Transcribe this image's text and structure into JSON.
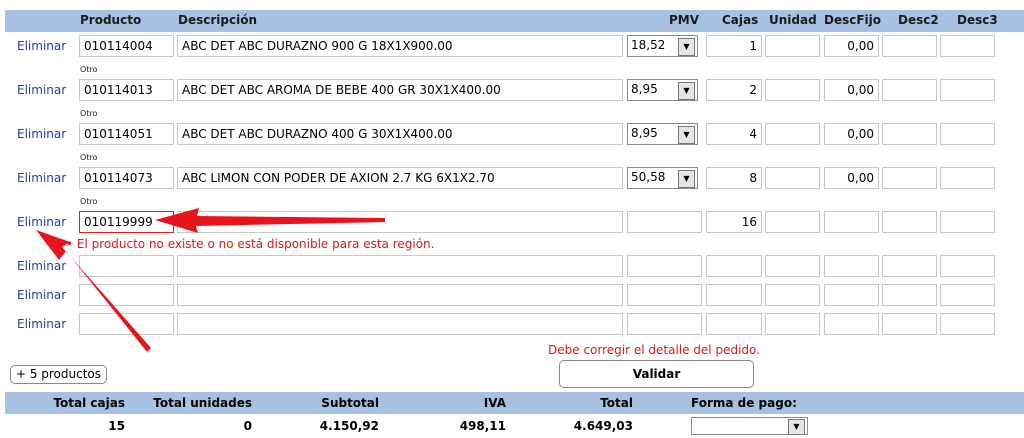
{
  "header": {
    "producto": "Producto",
    "descripcion": "Descripción",
    "pmv": "PMV",
    "cajas": "Cajas",
    "unidad": "Unidad",
    "descfijo": "DescFijo",
    "desc2": "Desc2",
    "desc3": "Desc3"
  },
  "rows": [
    {
      "action": "Eliminar",
      "code": "010114004",
      "desc": "ABC DET ABC DURAZNO 900 G 18X1X900.00",
      "pmv": "18,52",
      "cajas": "1",
      "unidad": "",
      "descfijo": "0,00",
      "desc2": "",
      "desc3": "",
      "otro": "Otro"
    },
    {
      "action": "Eliminar",
      "code": "010114013",
      "desc": "ABC DET ABC AROMA DE BEBE 400 GR 30X1X400.00",
      "pmv": "8,95",
      "cajas": "2",
      "unidad": "",
      "descfijo": "0,00",
      "desc2": "",
      "desc3": "",
      "otro": "Otro"
    },
    {
      "action": "Eliminar",
      "code": "010114051",
      "desc": "ABC DET ABC DURAZNO 400 G 30X1X400.00",
      "pmv": "8,95",
      "cajas": "4",
      "unidad": "",
      "descfijo": "0,00",
      "desc2": "",
      "desc3": "",
      "otro": "Otro"
    },
    {
      "action": "Eliminar",
      "code": "010114073",
      "desc": "ABC LIMON CON PODER DE AXION 2.7 KG 6X1X2.70",
      "pmv": "50,58",
      "cajas": "8",
      "unidad": "",
      "descfijo": "0,00",
      "desc2": "",
      "desc3": "",
      "otro": "Otro"
    },
    {
      "action": "Eliminar",
      "code": "010119999",
      "desc": "",
      "pmv": "",
      "cajas": "16",
      "unidad": "",
      "descfijo": "",
      "desc2": "",
      "desc3": ""
    },
    {
      "action": "Eliminar",
      "code": "",
      "desc": "",
      "pmv": "",
      "cajas": "",
      "unidad": "",
      "descfijo": "",
      "desc2": "",
      "desc3": ""
    },
    {
      "action": "Eliminar",
      "code": "",
      "desc": "",
      "pmv": "",
      "cajas": "",
      "unidad": "",
      "descfijo": "",
      "desc2": "",
      "desc3": ""
    },
    {
      "action": "Eliminar",
      "code": "",
      "desc": "",
      "pmv": "",
      "cajas": "",
      "unidad": "",
      "descfijo": "",
      "desc2": "",
      "desc3": ""
    }
  ],
  "row_error": "• El producto no existe o no está disponible para esta región.",
  "detail_error": "Debe corregir el detalle del pedido.",
  "add_products_label": "+ 5 productos",
  "validate_label": "Validar",
  "totals": {
    "headers": {
      "total_cajas": "Total cajas",
      "total_unidades": "Total unidades",
      "subtotal": "Subtotal",
      "iva": "IVA",
      "total": "Total",
      "forma_pago": "Forma de pago:"
    },
    "values": {
      "total_cajas": "15",
      "total_unidades": "0",
      "subtotal": "4.150,92",
      "iva": "498,11",
      "total": "4.649,03",
      "forma_pago": ""
    }
  },
  "colors": {
    "header_bg": "#a7c1e3",
    "error": "#d51b1b",
    "link": "#1f3fa8",
    "arrow": "#e8141b"
  }
}
